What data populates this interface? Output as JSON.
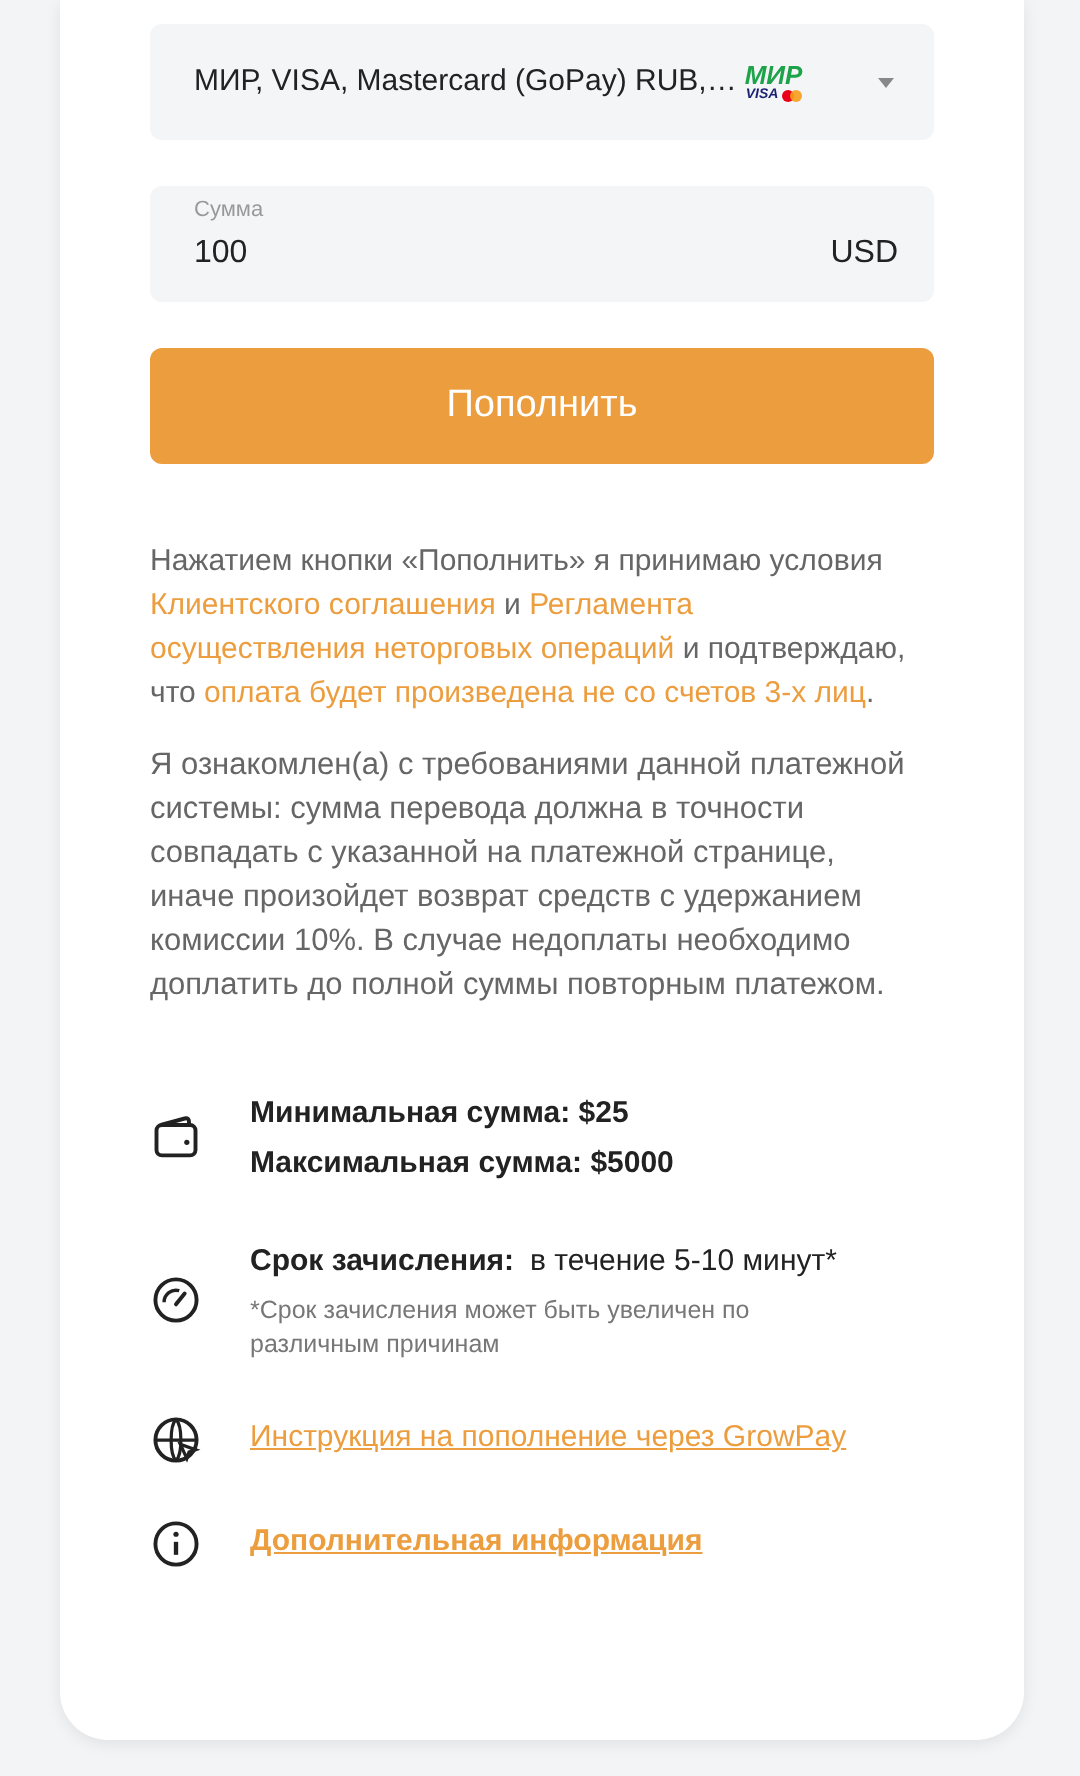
{
  "payment_method": {
    "value": "МИР, VISA, Mastercard (GoPay) RUB,…",
    "logo_text": "МИР",
    "logo_sub": "VISA"
  },
  "amount": {
    "label": "Сумма",
    "value": "100",
    "currency": "USD"
  },
  "submit_button": "Пополнить",
  "consent": [
    {
      "kind": "text",
      "text": "Нажатием кнопки «Пополнить» я принимаю условия "
    },
    {
      "kind": "link",
      "parts": [
        "Клиентского соглашения"
      ]
    },
    {
      "kind": "text",
      "text": " и "
    },
    {
      "kind": "link",
      "parts": [
        "Регламента",
        "осуществления неторговых операций"
      ]
    },
    {
      "kind": "text",
      "text": " и подтверждаю, что "
    },
    {
      "kind": "link",
      "parts": [
        "оплата будет произведена не со",
        "счетов 3-х лиц"
      ]
    },
    {
      "kind": "text",
      "text": "."
    }
  ],
  "notice": "Я ознакомлен(а) с требованиями данной платежной системы: сумма перевода должна в точности совпадать с указанной на платежной странице, иначе произойдет возврат средств с удержанием комиссии 10%. В случае недоплаты необходимо доплатить до полной суммы повторным платежом.",
  "info": [
    {
      "kind": "limits",
      "lines": [
        "Минимальная сумма: $25",
        "Максимальная сумма: $5000"
      ]
    },
    {
      "kind": "time",
      "label": "Срок зачисления:",
      "value": "в течение 5-10 минут*",
      "note": "*Срок зачисления может быть увеличен по различным причинам"
    },
    {
      "kind": "guide",
      "link": "Инструкция на пополнение через GrowPay"
    },
    {
      "kind": "more",
      "link": "Дополнительная информация"
    }
  ]
}
